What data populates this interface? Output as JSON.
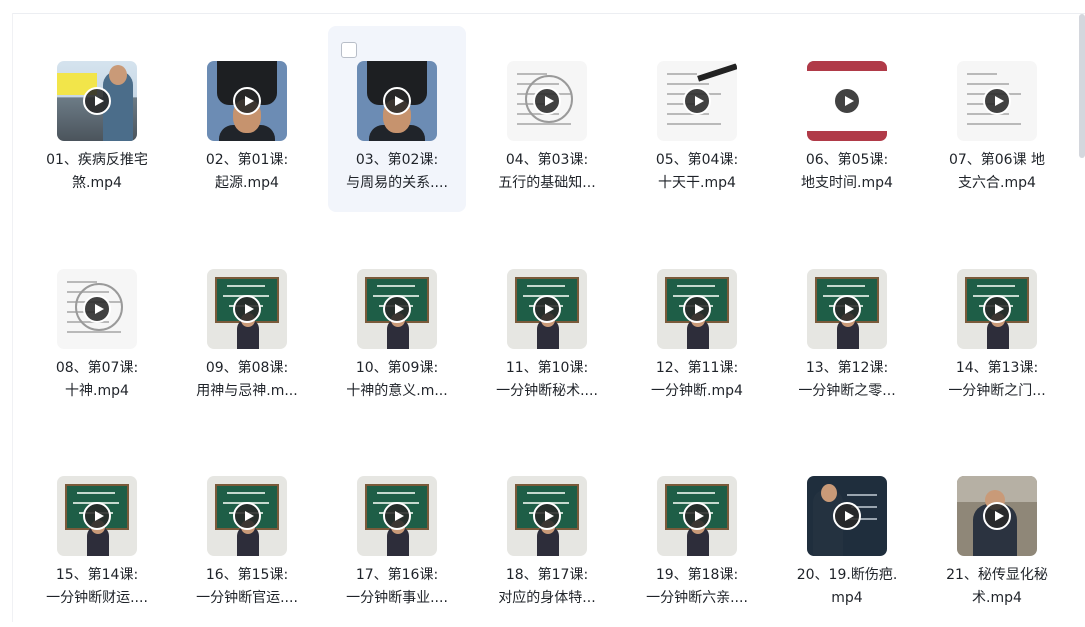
{
  "files": [
    {
      "name": [
        "01、疾病反推宅",
        "煞.mp4"
      ],
      "thumb": "office"
    },
    {
      "name": [
        "02、第01课:",
        "起源.mp4"
      ],
      "thumb": "yinyang"
    },
    {
      "name": [
        "03、第02课:",
        "与周易的关系...."
      ],
      "thumb": "yinyang",
      "hovered": true
    },
    {
      "name": [
        "04、第03课:",
        "五行的基础知..."
      ],
      "thumb": "paper-star"
    },
    {
      "name": [
        "05、第04课:",
        "十天干.mp4"
      ],
      "thumb": "paper-pen"
    },
    {
      "name": [
        "06、第05课:",
        "地支时间.mp4"
      ],
      "thumb": "table"
    },
    {
      "name": [
        "07、第06课 地",
        "支六合.mp4"
      ],
      "thumb": "paper"
    },
    {
      "name": [
        "08、第07课:",
        "十神.mp4"
      ],
      "thumb": "paper-star"
    },
    {
      "name": [
        "09、第08课:",
        "用神与忌神.m..."
      ],
      "thumb": "board"
    },
    {
      "name": [
        "10、第09课:",
        "十神的意义.m..."
      ],
      "thumb": "board"
    },
    {
      "name": [
        "11、第10课:",
        "一分钟断秘术...."
      ],
      "thumb": "board"
    },
    {
      "name": [
        "12、第11课:",
        "一分钟断.mp4"
      ],
      "thumb": "board"
    },
    {
      "name": [
        "13、第12课:",
        "一分钟断之零..."
      ],
      "thumb": "board"
    },
    {
      "name": [
        "14、第13课:",
        "一分钟断之门..."
      ],
      "thumb": "board"
    },
    {
      "name": [
        "15、第14课:",
        "一分钟断财运...."
      ],
      "thumb": "board"
    },
    {
      "name": [
        "16、第15课:",
        "一分钟断官运...."
      ],
      "thumb": "board"
    },
    {
      "name": [
        "17、第16课:",
        "一分钟断事业...."
      ],
      "thumb": "board"
    },
    {
      "name": [
        "18、第17课:",
        "对应的身体特..."
      ],
      "thumb": "board"
    },
    {
      "name": [
        "19、第18课:",
        "一分钟断六亲...."
      ],
      "thumb": "board"
    },
    {
      "name": [
        "20、19.断伤疤.",
        "mp4"
      ],
      "thumb": "dark"
    },
    {
      "name": [
        "21、秘传显化秘",
        "术.mp4"
      ],
      "thumb": "outdoor"
    }
  ]
}
